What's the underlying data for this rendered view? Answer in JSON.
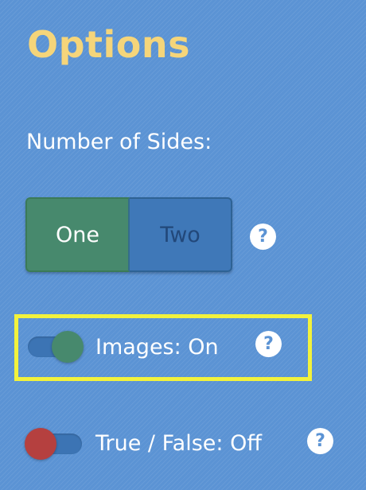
{
  "title": "Options",
  "number_of_sides": {
    "label": "Number of Sides:",
    "options": [
      "One",
      "Two"
    ],
    "selected": "One"
  },
  "images_toggle": {
    "label": "Images: On",
    "state": "on"
  },
  "true_false_toggle": {
    "label": "True / False: Off",
    "state": "off"
  },
  "help_glyph": "?",
  "icons": {
    "help": "help-question-icon"
  },
  "colors": {
    "background": "#5b93d4",
    "title": "#f5d57a",
    "selected_segment": "#47896d",
    "unselected_segment": "#3f78b8",
    "unselected_segment_text": "#22487a",
    "toggle_on_knob": "#47896d",
    "toggle_off_knob": "#b5403f",
    "toggle_track": "#3c74b4",
    "highlight_border": "#f2f23c"
  }
}
